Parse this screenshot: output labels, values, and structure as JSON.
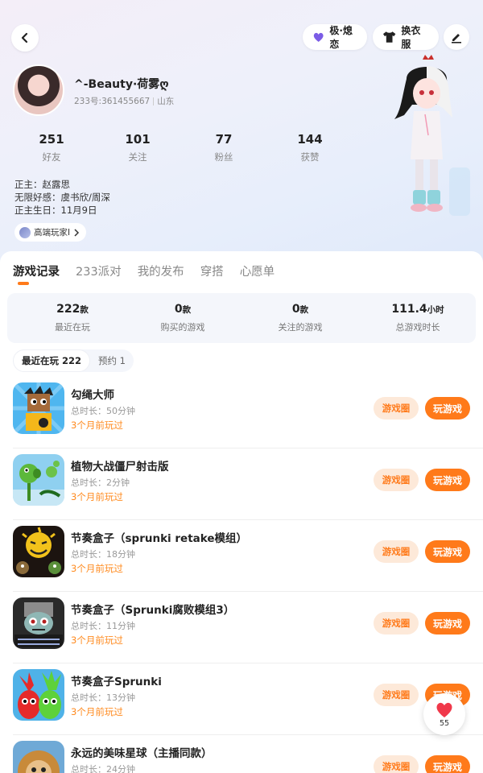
{
  "header": {
    "mood_label": "极·熄恋",
    "dress_label": "换衣服"
  },
  "profile": {
    "nickname": "^-Beauty·荷雾ღ",
    "uid": "233号:361455667",
    "region": "山东",
    "stats": [
      {
        "value": "251",
        "label": "好友"
      },
      {
        "value": "101",
        "label": "关注"
      },
      {
        "value": "77",
        "label": "粉丝"
      },
      {
        "value": "144",
        "label": "获赞"
      }
    ],
    "bio_lines": [
      "正主：赵露思",
      "无限好感：虞书欣/周深",
      "正主生日：11月9日"
    ],
    "tag": "高端玩家I"
  },
  "tabs": [
    "游戏记录",
    "233派对",
    "我的发布",
    "穿搭",
    "心愿单"
  ],
  "summary": [
    {
      "value": "222",
      "unit": "款",
      "label": "最近在玩"
    },
    {
      "value": "0",
      "unit": "款",
      "label": "购买的游戏"
    },
    {
      "value": "0",
      "unit": "款",
      "label": "关注的游戏"
    },
    {
      "value": "111.4",
      "unit": "小时",
      "label": "总游戏时长"
    }
  ],
  "filters": [
    "最近在玩 222",
    "预约 1"
  ],
  "games": [
    {
      "title": "勾绳大师",
      "duration": "总时长：50分钟",
      "ago": "3个月前玩过"
    },
    {
      "title": "植物大战僵尸射击版",
      "duration": "总时长：2分钟",
      "ago": "3个月前玩过"
    },
    {
      "title": "节奏盒子（sprunki retake模组）",
      "duration": "总时长：18分钟",
      "ago": "3个月前玩过"
    },
    {
      "title": "节奏盒子（Sprunki腐败模组3）",
      "duration": "总时长：11分钟",
      "ago": "3个月前玩过"
    },
    {
      "title": "节奏盒子Sprunki",
      "duration": "总时长：13分钟",
      "ago": "3个月前玩过"
    },
    {
      "title": "永远的美味星球（主播同款）",
      "duration": "总时长：24分钟",
      "ago": ""
    }
  ],
  "buttons": {
    "circle": "游戏圈",
    "play": "玩游戏"
  },
  "fab": {
    "count": "55"
  },
  "colors": {
    "accent": "#ff7a1a",
    "accent_soft": "#fde9d9",
    "heart": "#f0384a"
  }
}
